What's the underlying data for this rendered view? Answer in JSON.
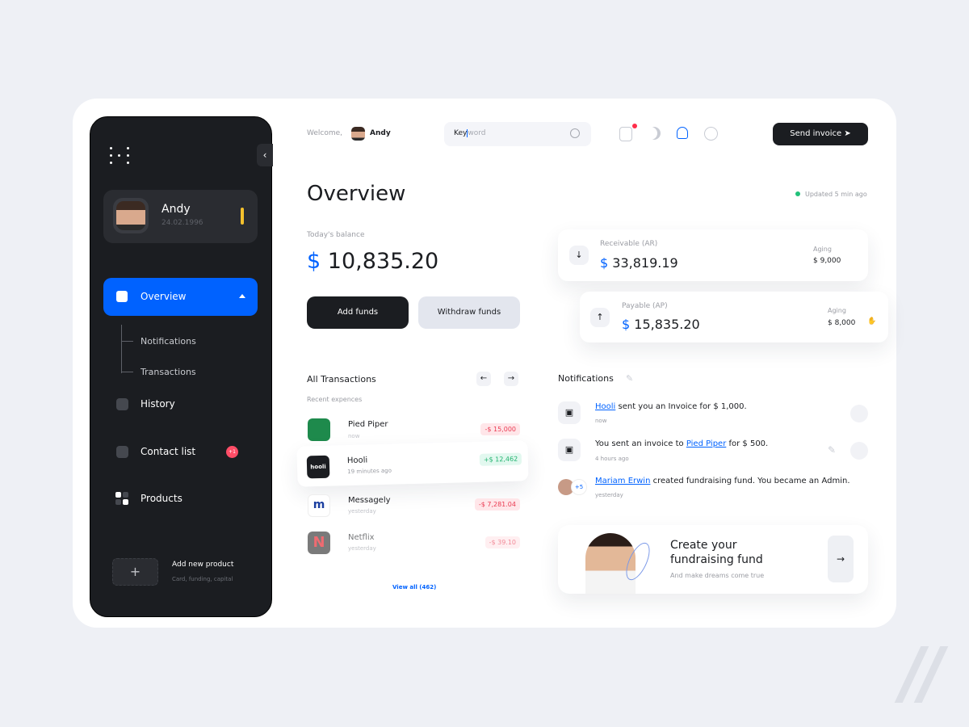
{
  "sidebar": {
    "user": {
      "name": "Andy",
      "dob": "24.02.1996"
    },
    "nav": [
      {
        "label": "Overview",
        "active": true,
        "children": [
          "Notifications",
          "Transactions"
        ]
      },
      {
        "label": "History"
      },
      {
        "label": "Contact list",
        "badge": "+1"
      },
      {
        "label": "Products"
      }
    ],
    "add_product": {
      "title": "Add new product",
      "subtitle": "Card, funding, capital",
      "icon": "plus-icon"
    }
  },
  "header": {
    "welcome": "Welcome,",
    "user": "Andy",
    "search": {
      "value": "Key",
      "placeholder": "word"
    },
    "icons": [
      "chart-icon",
      "moon-icon",
      "bell-icon",
      "gear-icon"
    ],
    "send_invoice": "Send invoice"
  },
  "overview": {
    "title": "Overview",
    "updated": "Updated 5 min ago",
    "balance_label": "Today's balance",
    "currency": "$",
    "balance": "10,835.20",
    "add_funds": "Add funds",
    "withdraw_funds": "Withdraw funds"
  },
  "receivable": {
    "label": "Receivable (AR)",
    "currency": "$",
    "amount": "33,819.19",
    "aging_label": "Aging",
    "aging": "$ 9,000"
  },
  "payable": {
    "label": "Payable (AP)",
    "currency": "$",
    "amount": "15,835.20",
    "aging_label": "Aging",
    "aging": "$ 8,000"
  },
  "transactions": {
    "title": "All Transactions",
    "subtitle": "Recent expences",
    "items": [
      {
        "name": "Pied Piper",
        "time": "now",
        "amount": "-$ 15,000",
        "type": "neg"
      },
      {
        "name": "Hooli",
        "time": "19 minutes ago",
        "amount": "+$ 12,462",
        "type": "pos"
      },
      {
        "name": "Messagely",
        "time": "yesterday",
        "amount": "-$ 7,281.04",
        "type": "neg"
      },
      {
        "name": "Netflix",
        "time": "yesterday",
        "amount": "-$ 39.10",
        "type": "neg"
      }
    ],
    "view_all": "View all (462)"
  },
  "notifications": {
    "title": "Notifications",
    "items": [
      {
        "link": "Hooli",
        "text": " sent you an Invoice for $ 1,000.",
        "time": "now"
      },
      {
        "pre": "You sent an invoice to ",
        "link": "Pied Piper",
        "text": " for $ 500.",
        "time": "4 hours ago"
      },
      {
        "link": "Mariam Erwin",
        "text": " created fundraising fund. You became an Admin.",
        "time": "yesterday",
        "extra": "+5"
      }
    ]
  },
  "fundraising": {
    "title": "Create your fundraising fund",
    "subtitle": "And make dreams come true"
  },
  "colors": {
    "accent": "#0062ff",
    "dark": "#1b1d21",
    "negative": "#ea3b52",
    "positive": "#21b36e",
    "warning": "#f5c12d"
  }
}
